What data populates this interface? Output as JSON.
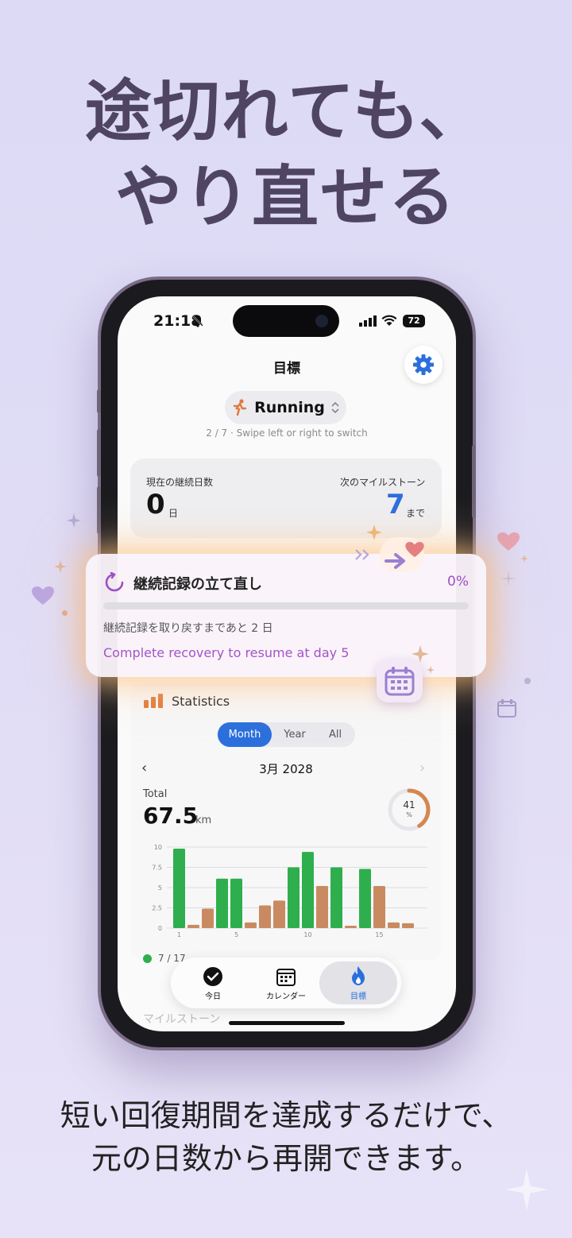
{
  "headline": {
    "line1": "途切れても、",
    "line2": "やり直せる"
  },
  "subline": {
    "line1": "短い回復期間を達成するだけで、",
    "line2": "元の日数から再開できます。"
  },
  "status_bar": {
    "time": "21:18",
    "battery": "72"
  },
  "header": {
    "title": "目標"
  },
  "goal_picker": {
    "label": "Running",
    "hint": "2 / 7 · Swipe left or right to switch"
  },
  "streak": {
    "current_label": "現在の継続日数",
    "current_value": "0",
    "current_unit": "日",
    "milestone_label": "次のマイルストーン",
    "milestone_value": "7",
    "milestone_unit": "まで"
  },
  "recovery": {
    "title": "継続記録の立て直し",
    "percent": "0%",
    "progress": 0,
    "days_left": "継続記録を取り戻すまであと 2 日",
    "message_en": "Complete recovery to resume at day 5"
  },
  "statistics": {
    "title": "Statistics",
    "tabs": [
      "Month",
      "Year",
      "All"
    ],
    "active_tab": "Month",
    "period": "3月 2028",
    "total_label": "Total",
    "total_value": "67.5",
    "total_unit": "km",
    "ring_value": "41",
    "ring_unit": "%"
  },
  "chart_data": {
    "type": "bar",
    "yticks": [
      "10",
      "7.5",
      "5",
      "2.5",
      "0"
    ],
    "xticks": [
      "1",
      "5",
      "10",
      "15"
    ],
    "ylim": [
      0,
      10
    ],
    "values": [
      9.8,
      0.4,
      2.4,
      6.1,
      6.1,
      0.7,
      2.8,
      3.4,
      7.5,
      9.4,
      5.2,
      7.5,
      0.3,
      7.3,
      5.2,
      0.7,
      0.6
    ],
    "colors": [
      "#2fae4e",
      "#c98a62",
      "#c98a62",
      "#2fae4e",
      "#2fae4e",
      "#c98a62",
      "#c98a62",
      "#c98a62",
      "#2fae4e",
      "#2fae4e",
      "#c98a62",
      "#2fae4e",
      "#c98a62",
      "#2fae4e",
      "#c98a62",
      "#c98a62",
      "#c98a62"
    ]
  },
  "behind": {
    "row": "7 / 17",
    "milestones": "マイルストーン"
  },
  "tabbar": {
    "today": "今日",
    "calendar": "カレンダー",
    "goals": "目標"
  },
  "colors": {
    "accent": "#2b6fdd",
    "purple": "#a552c9",
    "headline": "#4f4563"
  }
}
